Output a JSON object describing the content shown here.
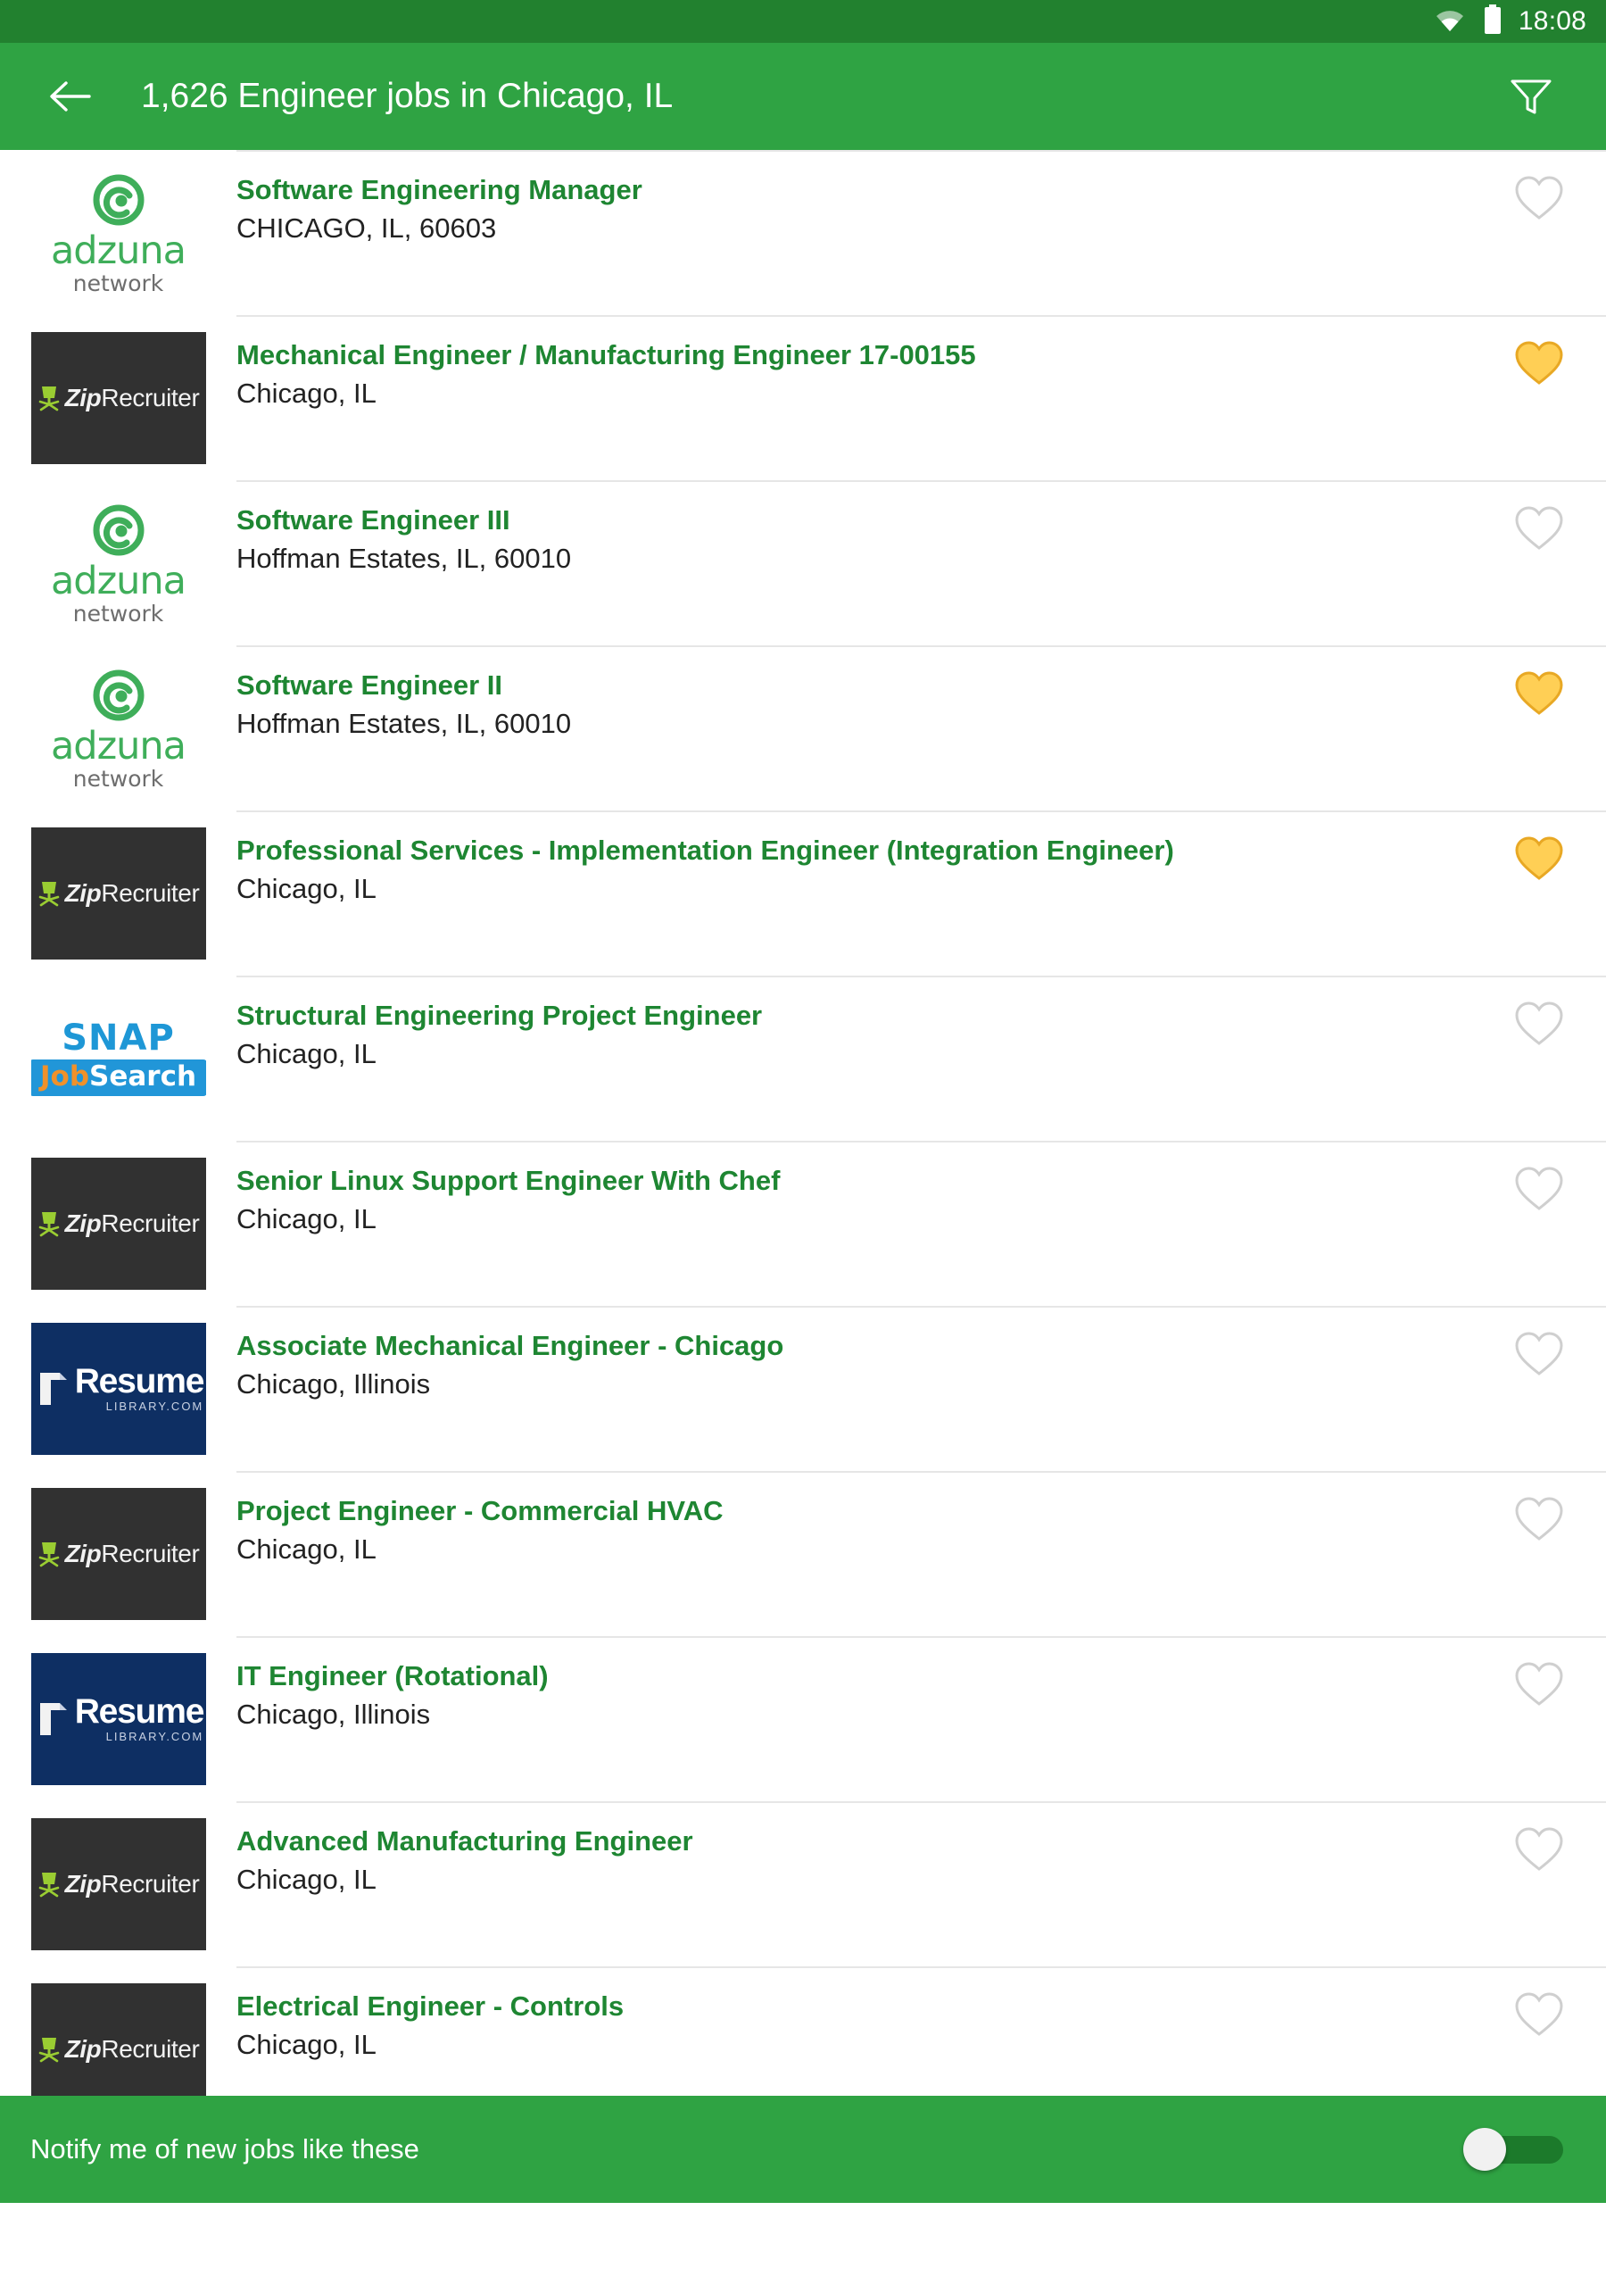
{
  "status_bar": {
    "time": "18:08",
    "wifi_icon": "wifi-icon",
    "battery_icon": "battery-full-icon",
    "background_color": "#22812F"
  },
  "app_bar": {
    "back_icon": "arrow-left-icon",
    "title": "1,626 Engineer jobs in Chicago, IL",
    "filter_icon": "filter-funnel-icon",
    "background_color": "#2FA343"
  },
  "theme": {
    "accent_green": "#2FA343",
    "title_green": "#1E8632",
    "status_green": "#22812F",
    "favorite_yellow": "#FFCF55",
    "favorite_outline": "#E8A824",
    "heart_empty_stroke": "#CFCFCF"
  },
  "jobs": [
    {
      "title": "Software Engineering Manager",
      "location": "CHICAGO, IL, 60603",
      "source": "adzuna",
      "source_label": "adzuna",
      "source_sub": "network",
      "favorited": false
    },
    {
      "title": "Mechanical Engineer / Manufacturing Engineer 17-00155",
      "location": "Chicago, IL",
      "source": "ziprecruiter",
      "source_label_a": "Zip",
      "source_label_b": "Recruiter",
      "favorited": true
    },
    {
      "title": "Software Engineer III",
      "location": "Hoffman Estates, IL, 60010",
      "source": "adzuna",
      "source_label": "adzuna",
      "source_sub": "network",
      "favorited": false
    },
    {
      "title": "Software Engineer II",
      "location": "Hoffman Estates, IL, 60010",
      "source": "adzuna",
      "source_label": "adzuna",
      "source_sub": "network",
      "favorited": true
    },
    {
      "title": "Professional Services - Implementation Engineer (Integration Engineer)",
      "location": "Chicago, IL",
      "source": "ziprecruiter",
      "source_label_a": "Zip",
      "source_label_b": "Recruiter",
      "favorited": true
    },
    {
      "title": "Structural Engineering Project Engineer",
      "location": "Chicago, IL",
      "source": "snap",
      "source_label_top": "SNAP",
      "source_label_job": "Job",
      "source_label_search": "Search",
      "favorited": false
    },
    {
      "title": "Senior Linux Support Engineer With Chef",
      "location": "Chicago, IL",
      "source": "ziprecruiter",
      "source_label_a": "Zip",
      "source_label_b": "Recruiter",
      "favorited": false
    },
    {
      "title": "Associate Mechanical Engineer - Chicago",
      "location": "Chicago, Illinois",
      "source": "resumelibrary",
      "source_label": "Resume",
      "source_sub": "LIBRARY.COM",
      "favorited": false
    },
    {
      "title": "Project Engineer - Commercial HVAC",
      "location": "Chicago, IL",
      "source": "ziprecruiter",
      "source_label_a": "Zip",
      "source_label_b": "Recruiter",
      "favorited": false
    },
    {
      "title": "IT Engineer (Rotational)",
      "location": "Chicago, Illinois",
      "source": "resumelibrary",
      "source_label": "Resume",
      "source_sub": "LIBRARY.COM",
      "favorited": false
    },
    {
      "title": "Advanced Manufacturing Engineer",
      "location": "Chicago, IL",
      "source": "ziprecruiter",
      "source_label_a": "Zip",
      "source_label_b": "Recruiter",
      "favorited": false
    },
    {
      "title": "Electrical Engineer - Controls",
      "location": "Chicago, IL",
      "source": "ziprecruiter",
      "source_label_a": "Zip",
      "source_label_b": "Recruiter",
      "favorited": false
    }
  ],
  "notify_bar": {
    "label": "Notify me of new jobs like these",
    "toggle_state": "off",
    "toggle_icon": "toggle-switch"
  }
}
